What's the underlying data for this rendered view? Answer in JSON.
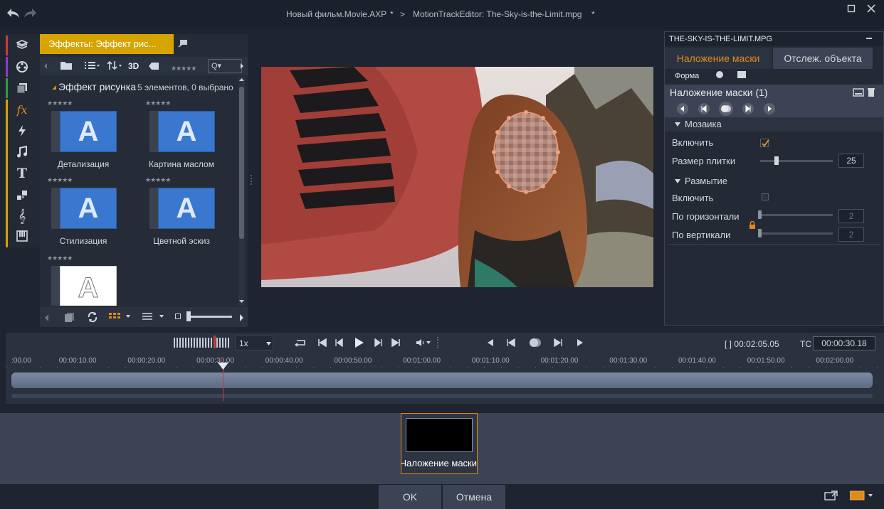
{
  "titlebar": {
    "project": "Новый фильм.Movie.AXP",
    "project_mod": "*",
    "separator": ">",
    "editor": "MotionTrackEditor: The-Sky-is-the-Limit.mpg",
    "editor_mod": "*"
  },
  "library": {
    "tab_label": "Эффекты: Эффект рис...",
    "toolbar_3d": "3D",
    "search_placeholder": "Q▾",
    "category_title": "Эффект рисунка",
    "count_text": "5 элементов, 0 выбрано",
    "items": [
      {
        "label": "Детализация",
        "letter": "A"
      },
      {
        "label": "Картина маслом",
        "letter": "A"
      },
      {
        "label": "Стилизация",
        "letter": "A"
      },
      {
        "label": "Цветной эскиз",
        "letter": "A"
      },
      {
        "label": "",
        "letter": "A"
      }
    ]
  },
  "right_panel": {
    "file_name": "THE-SKY-IS-THE-LIMIT.MPG",
    "tab_mask": "Наложение маски",
    "tab_track": "Отслеж. объекта",
    "shape_label": "Форма",
    "mask_title": "Наложение маски (1)",
    "section_mosaic": "Мозаика",
    "mosaic_enable": "Включить",
    "tile_size_label": "Размер плитки",
    "tile_size_value": "25",
    "tile_size_fraction": 0.25,
    "section_blur": "Размытие",
    "blur_enable": "Включить",
    "horizontal_label": "По горизонтали",
    "horizontal_value": "2",
    "vertical_label": "По вертикали",
    "vertical_value": "2"
  },
  "transport": {
    "speed": "1x",
    "duration": "[ ] 00:02:05.05",
    "tc_label": "TC",
    "timecode": "00:00:30.18",
    "ruler": [
      ":00.00",
      "00:00:10.00",
      "00:00:20.00",
      "00:00:30.00",
      "00:00:40.00",
      "00:00:50.00",
      "00:01:00.00",
      "00:01:10.00",
      "00:01:20.00",
      "00:01:30.00",
      "00:01:40.00",
      "00:01:50.00",
      "00:02:00.00"
    ]
  },
  "clip": {
    "label": "Наложение маски"
  },
  "buttons": {
    "ok": "OK",
    "cancel": "Отмена"
  },
  "colors": {
    "accent": "#e08a1a",
    "tab_yellow": "#d6a400",
    "panel": "#232a36"
  }
}
